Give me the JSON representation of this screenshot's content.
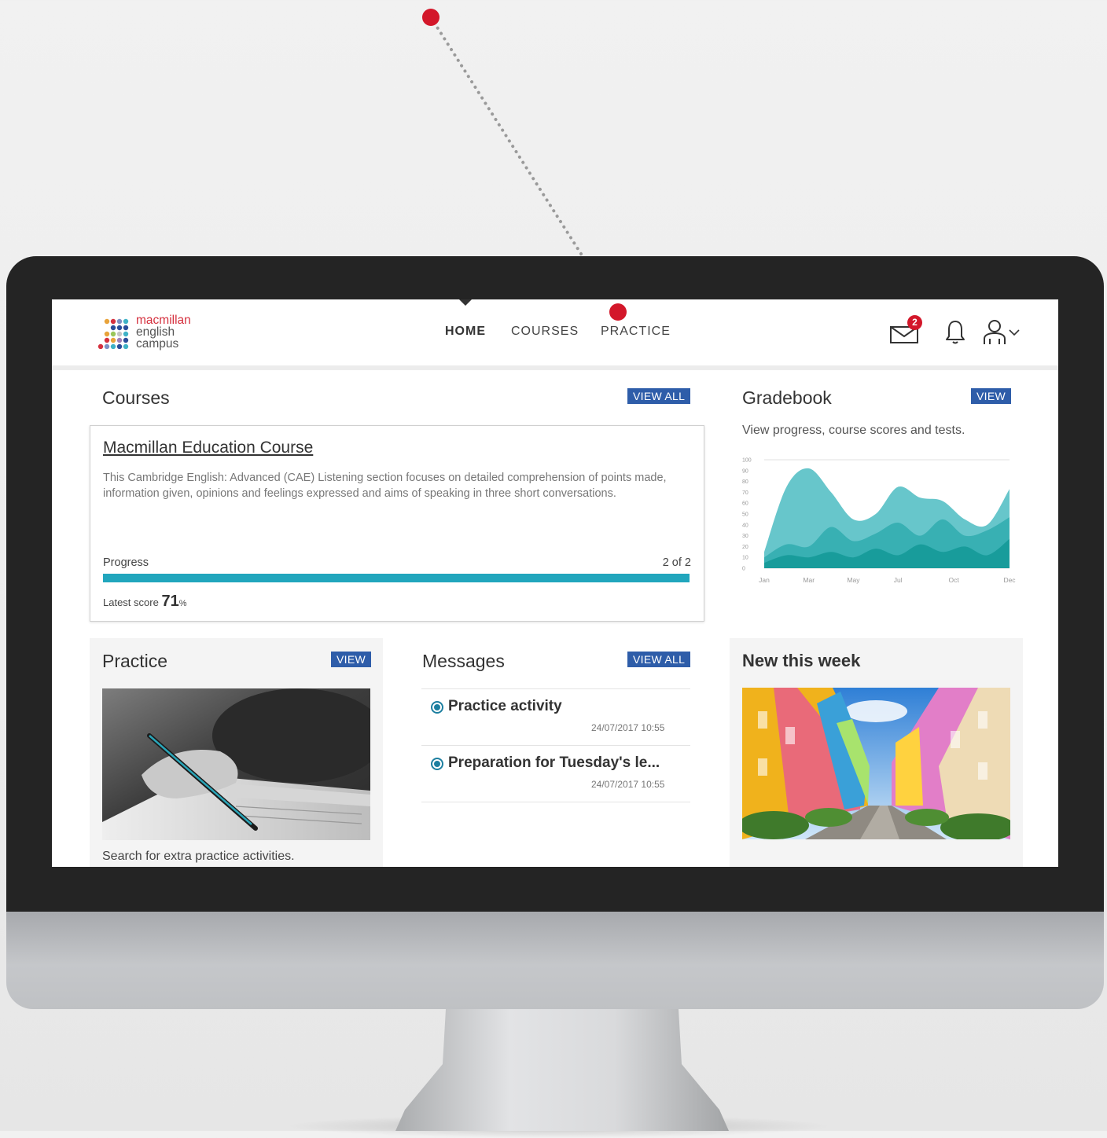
{
  "app": {
    "brand": {
      "line1": "macmillan",
      "line2": "english",
      "line3": "campus"
    },
    "colors": {
      "accent": "#2e5da9",
      "teal": "#21a6bd",
      "annotation": "#d3172a",
      "bezel": "#242424"
    }
  },
  "nav": {
    "items": [
      {
        "label": "HOME",
        "active": true
      },
      {
        "label": "COURSES",
        "active": false
      },
      {
        "label": "PRACTICE",
        "active": false
      }
    ],
    "mail_badge": "2",
    "icons": [
      "mail-icon",
      "bell-icon",
      "user-icon",
      "chevron-down-icon"
    ]
  },
  "courses": {
    "title": "Courses",
    "view_all": "VIEW ALL",
    "card": {
      "name": "Macmillan Education Course",
      "description": "This Cambridge English: Advanced (CAE) Listening section focuses on detailed comprehension of points made, information given, opinions and feelings expressed and aims of speaking in three short conversations.",
      "progress_label": "Progress",
      "progress_count": "2 of 2",
      "progress_fraction": 1.0,
      "latest_label": "Latest score",
      "latest_value": "71",
      "latest_unit": "%"
    }
  },
  "gradebook": {
    "title": "Gradebook",
    "view": "VIEW",
    "description": "View progress, course scores and tests."
  },
  "chart_data": {
    "type": "area",
    "title": "",
    "xlabel": "",
    "ylabel": "",
    "ylim": [
      0,
      100
    ],
    "y_ticks": [
      "100",
      "90",
      "80",
      "70",
      "60",
      "50",
      "40",
      "30",
      "20",
      "10",
      "0"
    ],
    "x_ticks": [
      "Jan",
      "Mar",
      "May",
      "Jul",
      "Oct",
      "Dec"
    ],
    "x": [
      0,
      1,
      2,
      3,
      4,
      5,
      6,
      7,
      8,
      9,
      10,
      11
    ],
    "series": [
      {
        "values": [
          15,
          75,
          92,
          70,
          45,
          50,
          75,
          65,
          62,
          45,
          40,
          73
        ]
      },
      {
        "values": [
          10,
          22,
          20,
          38,
          25,
          32,
          42,
          30,
          45,
          30,
          35,
          47
        ]
      },
      {
        "values": [
          5,
          12,
          10,
          15,
          10,
          18,
          12,
          22,
          15,
          20,
          12,
          27
        ]
      }
    ],
    "grid": false
  },
  "practice": {
    "title": "Practice",
    "view": "VIEW",
    "description": "Search for extra practice activities."
  },
  "messages": {
    "title": "Messages",
    "view_all": "VIEW ALL",
    "items": [
      {
        "title": "Practice activity",
        "time": "24/07/2017 10:55"
      },
      {
        "title": "Preparation for Tuesday's le...",
        "time": "24/07/2017 10:55"
      }
    ]
  },
  "new_this_week": {
    "title": "New this week"
  }
}
